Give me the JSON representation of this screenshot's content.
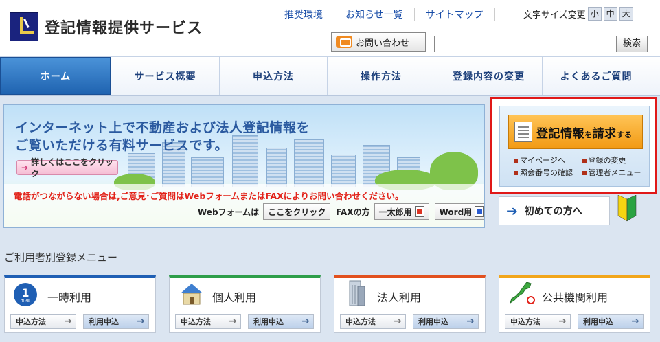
{
  "header": {
    "logo_text": "登記情報提供サービス",
    "links": [
      "推奨環境",
      "お知らせ一覧",
      "サイトマップ"
    ],
    "fontsize_label": "文字サイズ変更",
    "fontsize_options": [
      "小",
      "中",
      "大"
    ],
    "contact_label": "お問い合わせ",
    "search_button": "検索"
  },
  "nav": {
    "items": [
      "ホーム",
      "サービス概要",
      "申込方法",
      "操作方法",
      "登録内容の変更",
      "よくあるご質問"
    ]
  },
  "banner": {
    "title_line1": "インターネット上で不動産および法人登記情報を",
    "title_line2": "ご覧いただける有料サービスです。",
    "detail_button": "詳しくはここをクリック",
    "notice": "電話がつながらない場合は,ご意見･ご質問はWebフォームまたはFAXによりお問い合わせください。",
    "webform_label": "Webフォームは",
    "webform_button": "ここをクリック",
    "fax_label": "FAXの方",
    "ichitaro_button": "一太郎用",
    "word_button": "Word用"
  },
  "request": {
    "main_big1": "登記情報",
    "main_small1": "を",
    "main_big2": "請求",
    "main_small2": "する",
    "links": [
      "マイページへ",
      "登録の変更",
      "照会番号の確認",
      "管理者メニュー"
    ],
    "first_time": "初めての方へ"
  },
  "menu": {
    "section_title": "ご利用者別登録メニュー",
    "cards": [
      {
        "title": "一時利用",
        "accent": "#1f5fb4",
        "b1": "申込方法",
        "b2": "利用申込"
      },
      {
        "title": "個人利用",
        "accent": "#2e9e4a",
        "b1": "申込方法",
        "b2": "利用申込"
      },
      {
        "title": "法人利用",
        "accent": "#e2501e",
        "b1": "申込方法",
        "b2": "利用申込"
      },
      {
        "title": "公共機関利用",
        "accent": "#f2a61b",
        "b1": "申込方法",
        "b2": "利用申込"
      }
    ]
  }
}
